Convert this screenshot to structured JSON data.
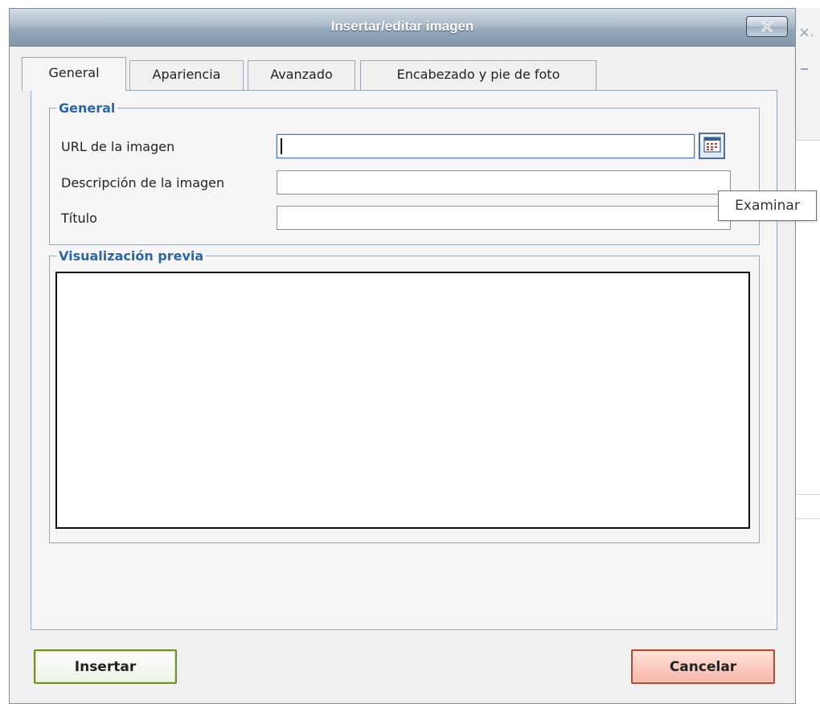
{
  "dialog": {
    "title": "Insertar/editar imagen",
    "close_label": "close"
  },
  "tabs": [
    {
      "label": "General",
      "active": true
    },
    {
      "label": "Apariencia",
      "active": false
    },
    {
      "label": "Avanzado",
      "active": false
    },
    {
      "label": "Encabezado y pie de foto",
      "active": false
    }
  ],
  "general_section": {
    "legend": "General",
    "fields": [
      {
        "label": "URL de la imagen",
        "value": ""
      },
      {
        "label": "Descripción de la imagen",
        "value": ""
      },
      {
        "label": "Título",
        "value": ""
      }
    ],
    "browse_tooltip": "Examinar"
  },
  "preview_section": {
    "legend": "Visualización previa"
  },
  "buttons": {
    "insert": "Insertar",
    "cancel": "Cancelar"
  },
  "colors": {
    "legend_text": "#2b67a8",
    "insert_border": "#6f8f2a",
    "cancel_border": "#b9462f"
  },
  "icons": {
    "close": "close-x-icon",
    "browse": "file-browser-icon"
  }
}
